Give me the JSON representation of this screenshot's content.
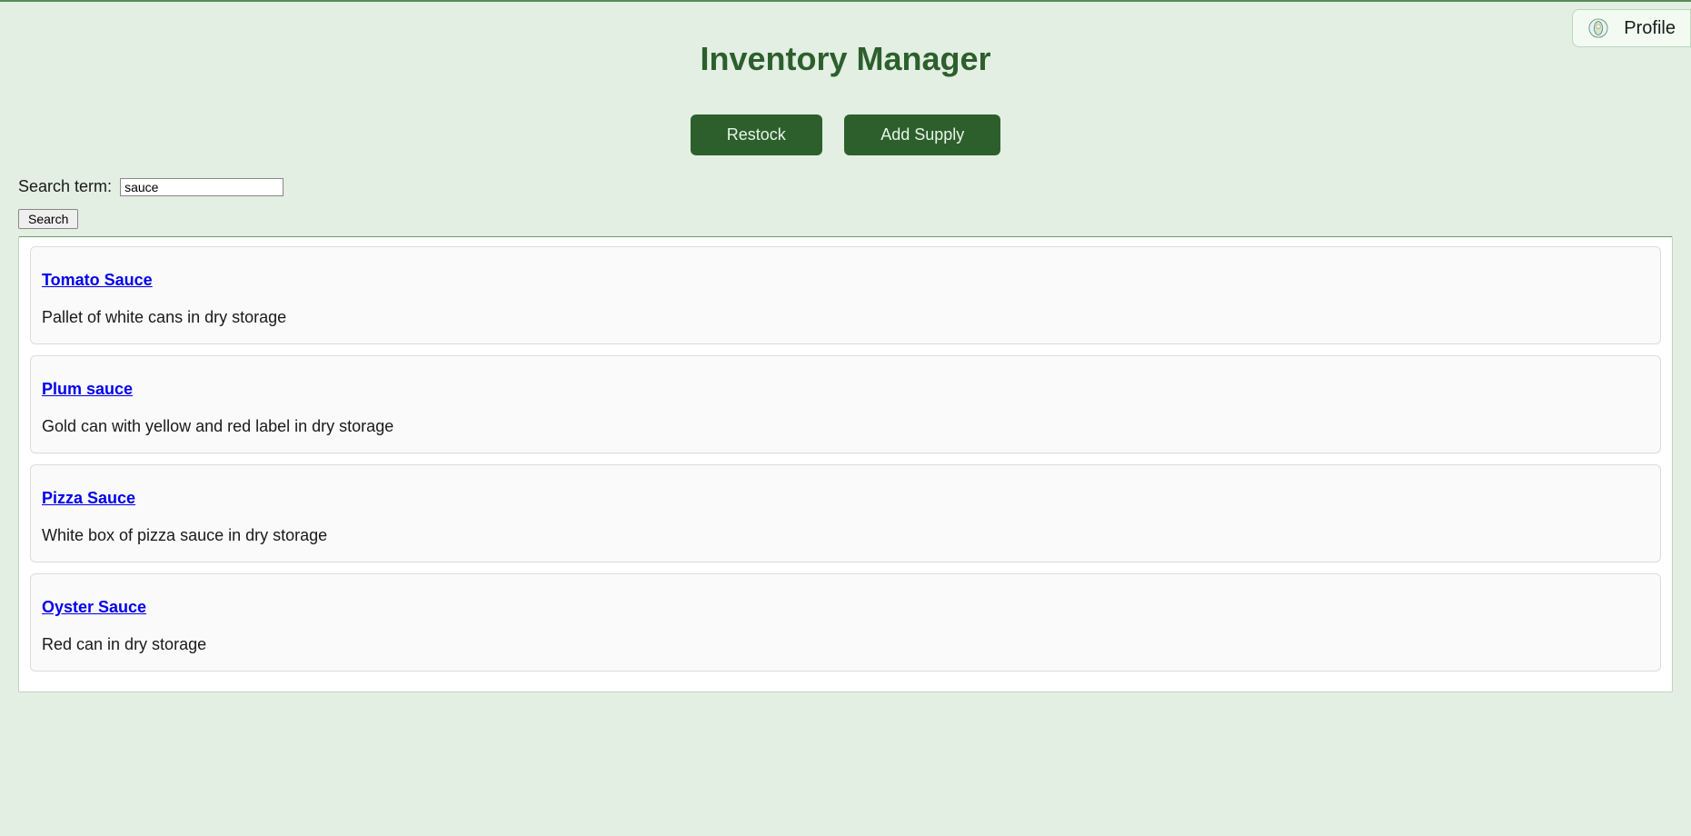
{
  "header": {
    "title": "Inventory Manager",
    "profile_label": "Profile"
  },
  "actions": {
    "restock_label": "Restock",
    "add_supply_label": "Add Supply"
  },
  "search": {
    "label": "Search term:",
    "value": "sauce",
    "button_label": "Search"
  },
  "results": [
    {
      "title": "Tomato Sauce",
      "description": "Pallet of white cans in dry storage"
    },
    {
      "title": "Plum sauce",
      "description": "Gold can with yellow and red label in dry storage"
    },
    {
      "title": "Pizza Sauce",
      "description": "White box of pizza sauce in dry storage"
    },
    {
      "title": "Oyster Sauce",
      "description": "Red can in dry storage"
    }
  ]
}
